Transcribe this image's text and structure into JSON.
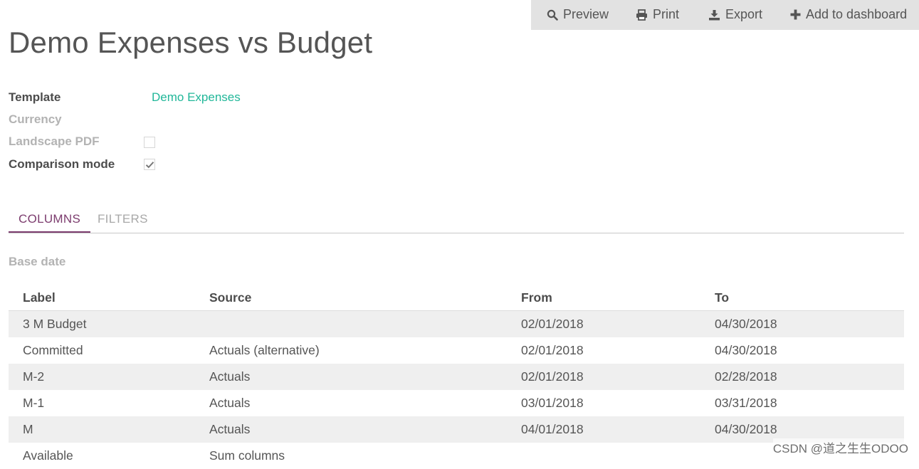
{
  "toolbar": {
    "preview_label": "Preview",
    "print_label": "Print",
    "export_label": "Export",
    "add_dashboard_label": "Add to dashboard"
  },
  "page": {
    "title": "Demo Expenses vs Budget"
  },
  "form": {
    "template_label": "Template",
    "template_value": "Demo Expenses",
    "currency_label": "Currency",
    "landscape_label": "Landscape PDF",
    "landscape_checked": false,
    "comparison_label": "Comparison mode",
    "comparison_checked": true
  },
  "tabs": [
    {
      "label": "COLUMNS",
      "active": true
    },
    {
      "label": "FILTERS",
      "active": false
    }
  ],
  "base_date_label": "Base date",
  "table": {
    "headers": [
      "Label",
      "Source",
      "From",
      "To"
    ],
    "rows": [
      [
        "3 M Budget",
        "",
        "02/01/2018",
        "04/30/2018"
      ],
      [
        "Committed",
        "Actuals (alternative)",
        "02/01/2018",
        "04/30/2018"
      ],
      [
        "M-2",
        "Actuals",
        "02/01/2018",
        "02/28/2018"
      ],
      [
        "M-1",
        "Actuals",
        "03/01/2018",
        "03/31/2018"
      ],
      [
        "M",
        "Actuals",
        "04/01/2018",
        "04/30/2018"
      ],
      [
        "Available",
        "Sum columns",
        "",
        ""
      ]
    ]
  },
  "watermark": "CSDN @道之生生ODOO",
  "colors": {
    "accent_purple": "#7c3c6e",
    "link_teal": "#21b799",
    "toolbar_bg": "#e2e2e2",
    "row_stripe": "#efefef"
  }
}
